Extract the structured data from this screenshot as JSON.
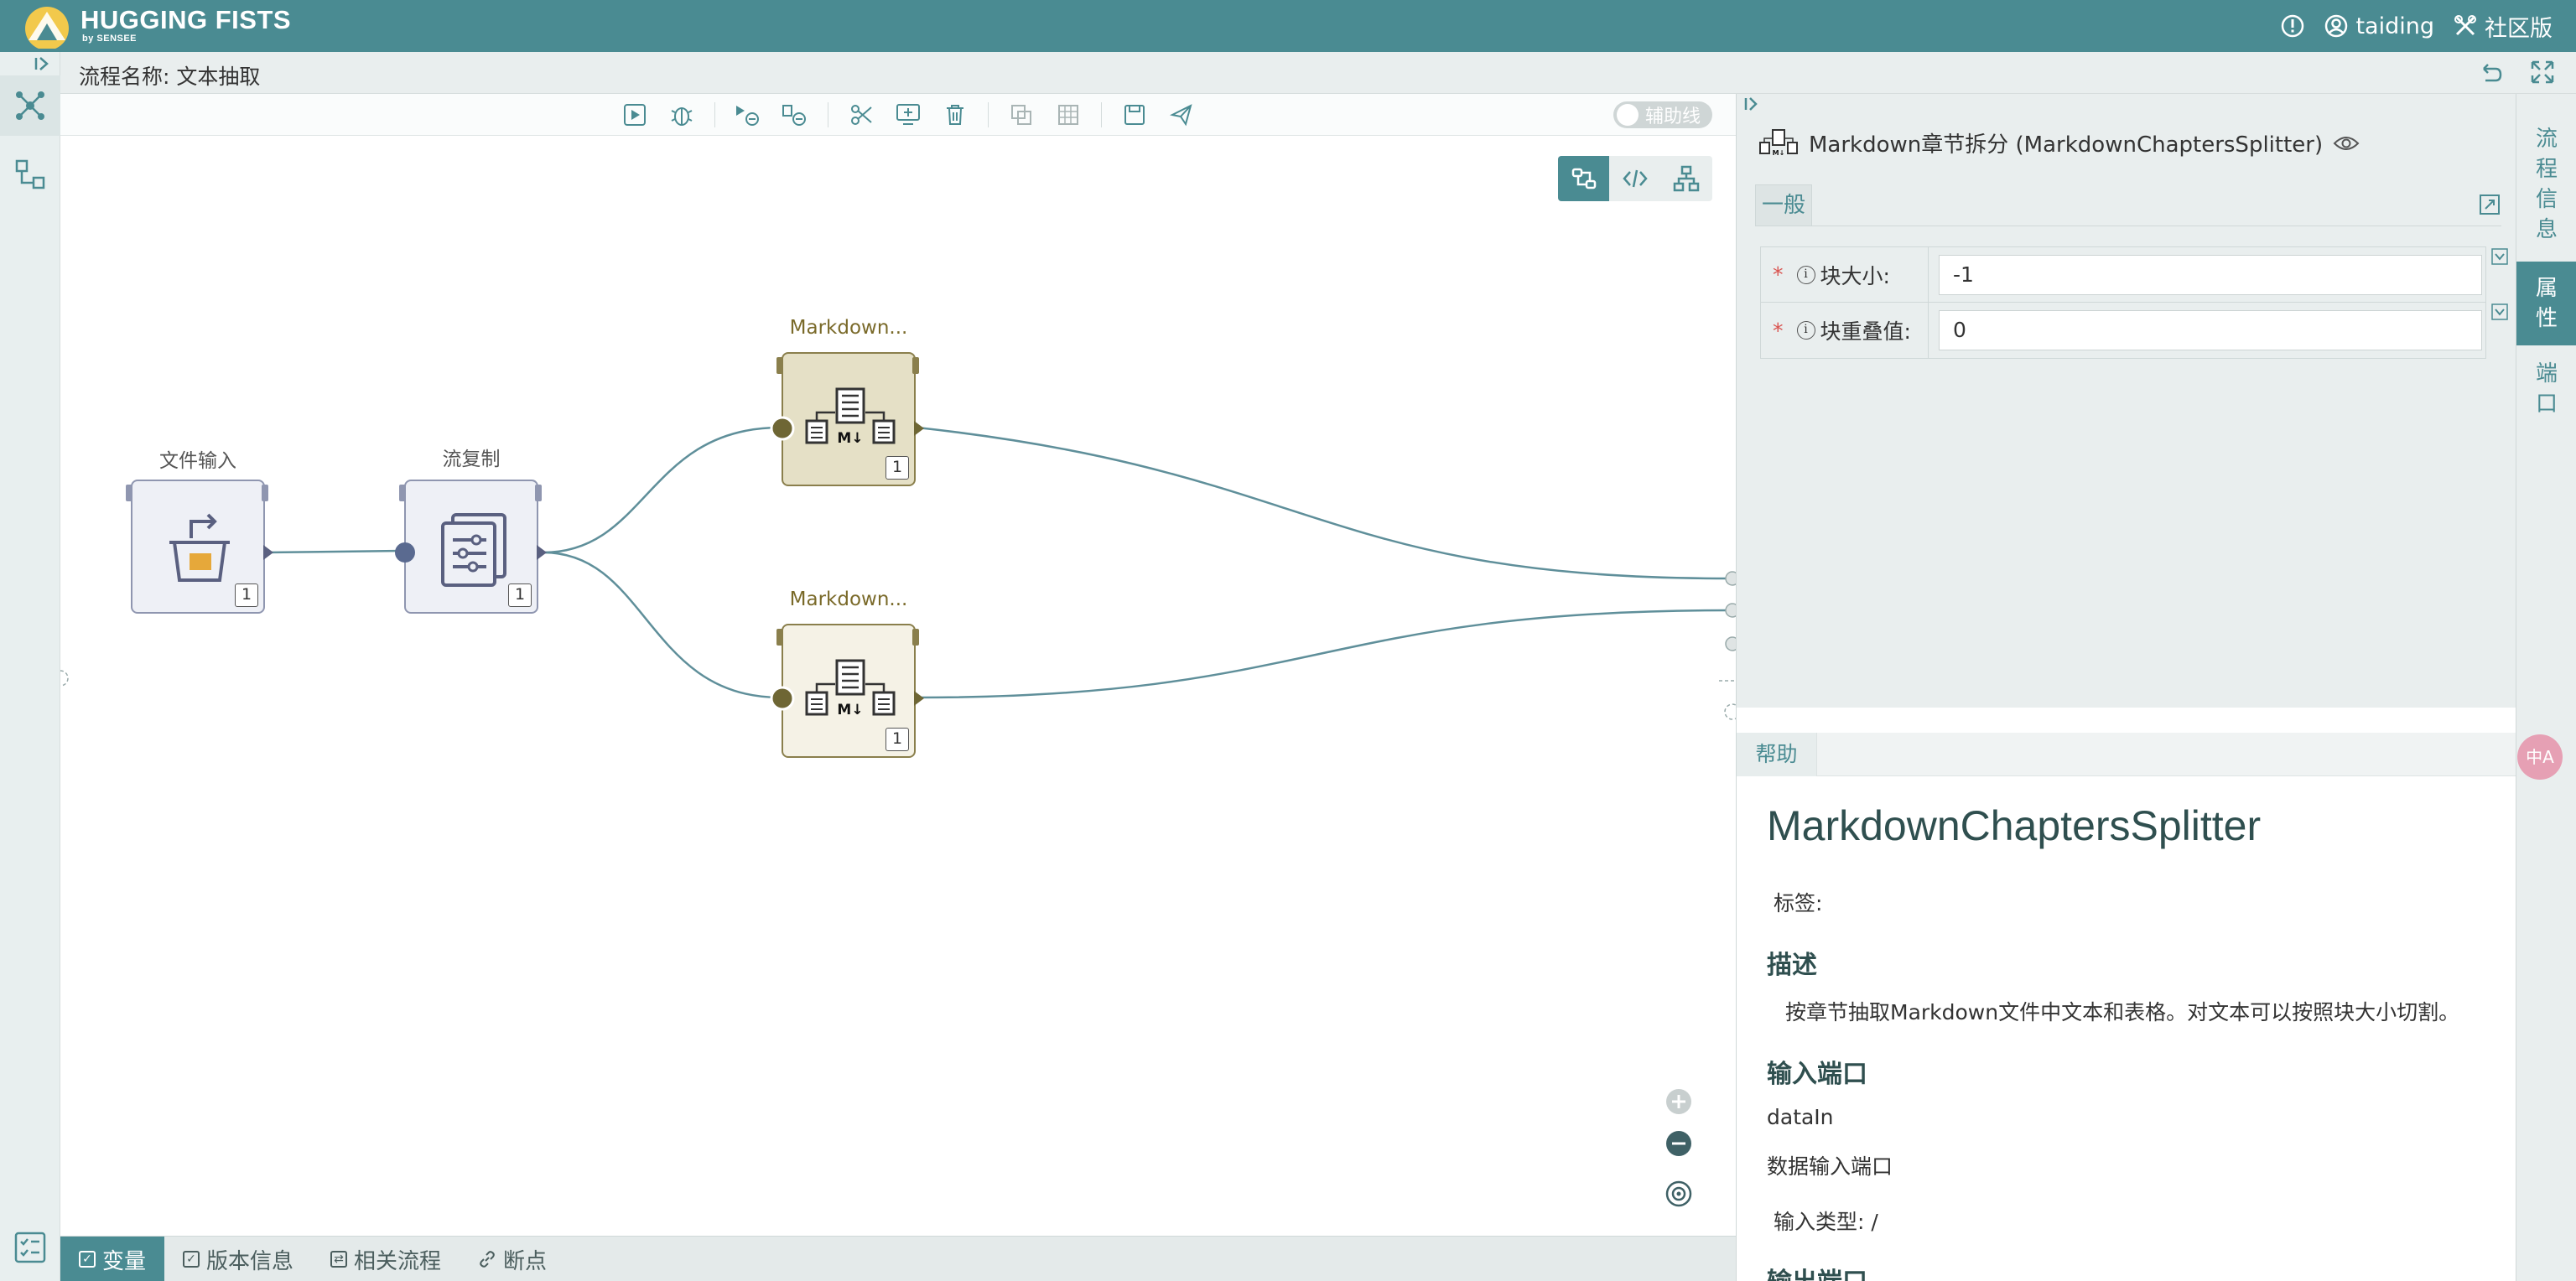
{
  "app": {
    "brand": "HUGGING FISTS",
    "brand_sub": "by SENSEE",
    "user": "taiding",
    "edition": "社区版"
  },
  "flow": {
    "name_label": "流程名称: 文本抽取"
  },
  "toolbar": {
    "assist_toggle_label": "辅助线"
  },
  "nodes": {
    "file_input": {
      "label": "文件输入",
      "count": "1"
    },
    "stream_copy": {
      "label": "流复制",
      "count": "1"
    },
    "md_top": {
      "label": "Markdown...",
      "count": "1"
    },
    "md_bottom": {
      "label": "Markdown...",
      "count": "1"
    }
  },
  "bottom_tabs": [
    {
      "label": "变量"
    },
    {
      "label": "版本信息"
    },
    {
      "label": "相关流程"
    },
    {
      "label": "断点"
    }
  ],
  "panel": {
    "title": "Markdown章节拆分 (MarkdownChaptersSplitter)",
    "tab_general": "一般",
    "props": [
      {
        "label": "块大小:",
        "value": "-1"
      },
      {
        "label": "块重叠值:",
        "value": "0"
      }
    ]
  },
  "help": {
    "tab": "帮助",
    "title": "MarkdownChaptersSplitter",
    "tags_label": "标签:",
    "desc_heading": "描述",
    "desc_text": "按章节抽取Markdown文件中文本和表格。对文本可以按照块大小切割。",
    "input_heading": "输入端口",
    "port_name": "dataIn",
    "port_desc": "数据输入端口",
    "input_type": "输入类型:  /",
    "output_heading": "输出端口"
  },
  "right_rail": {
    "flow_info": "流程信息",
    "properties": "属性",
    "ports": "端口"
  },
  "translate_badge": "中A",
  "colors": {
    "primary": "#4a8b92",
    "node_tan": "#e5e0c6",
    "node_gray": "#eef0f6"
  }
}
